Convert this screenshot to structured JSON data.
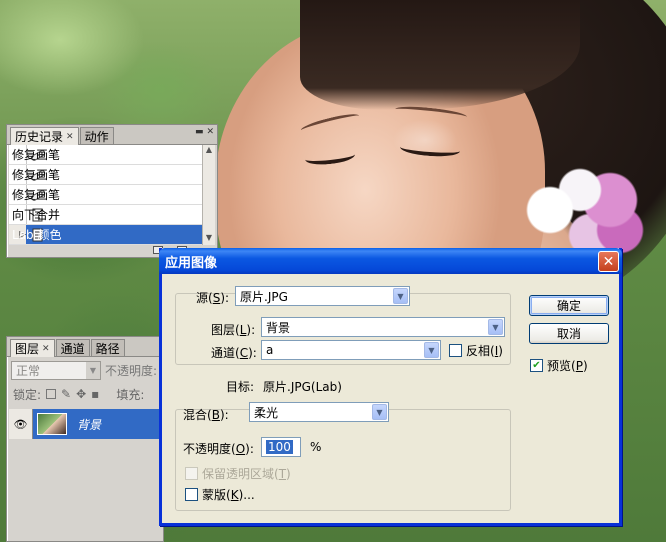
{
  "history_panel": {
    "tabs": [
      {
        "label": "历史记录",
        "active": true,
        "closable": true
      },
      {
        "label": "动作",
        "active": false,
        "closable": false
      }
    ],
    "items": [
      {
        "label": "修复画笔",
        "icon": "healing-brush-icon",
        "selected": false
      },
      {
        "label": "修复画笔",
        "icon": "healing-brush-icon",
        "selected": false
      },
      {
        "label": "修复画笔",
        "icon": "healing-brush-icon",
        "selected": false
      },
      {
        "label": "向下合并",
        "icon": "document-icon",
        "selected": false
      },
      {
        "label": "Lab 颜色",
        "icon": "document-icon",
        "selected": true
      }
    ]
  },
  "layers_panel": {
    "tabs": [
      {
        "label": "图层",
        "active": true,
        "closable": true
      },
      {
        "label": "通道",
        "active": false,
        "closable": false
      },
      {
        "label": "路径",
        "active": false,
        "closable": false
      }
    ],
    "blend_mode": "正常",
    "opacity_label": "不透明度:",
    "lock_label": "锁定:",
    "fill_label": "填充:",
    "layer_name": "背景"
  },
  "dialog": {
    "title": "应用图像",
    "source_label": "源",
    "source_key": "S",
    "source_value": "原片.JPG",
    "layer_label": "图层",
    "layer_key": "L",
    "layer_value": "背景",
    "channel_label": "通道",
    "channel_key": "C",
    "channel_value": "a",
    "invert_label": "反相",
    "invert_key": "I",
    "invert_checked": false,
    "target_label": "目标:",
    "target_value": "原片.JPG(Lab)",
    "blending_label": "混合",
    "blending_key": "B",
    "blending_value": "柔光",
    "opacity_label": "不透明度",
    "opacity_key": "O",
    "opacity_value": "100",
    "opacity_unit": "%",
    "preserve_label": "保留透明区域",
    "preserve_key": "T",
    "preserve_checked": false,
    "mask_label": "蒙版",
    "mask_key": "K",
    "mask_suffix": "...",
    "mask_checked": false,
    "ok_label": "确定",
    "cancel_label": "取消",
    "preview_label": "预览",
    "preview_key": "P",
    "preview_checked": true
  }
}
